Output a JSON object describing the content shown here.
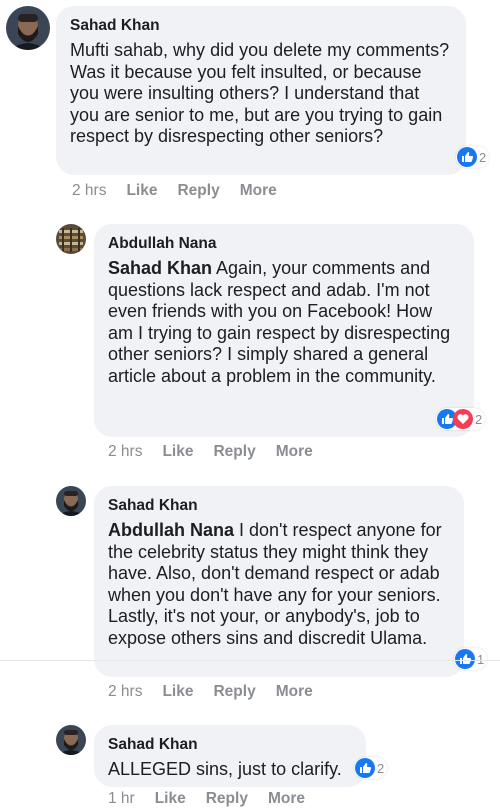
{
  "comments": [
    {
      "author": "Sahad Khan",
      "mention": "",
      "text": "Mufti sahab, why did you delete my comments? Was it because you felt insulted, or because you were insulting others? I understand that you are senior to me, but are you trying to gain respect by disrespecting other seniors?",
      "reaction_count": "2",
      "time": "2 hrs",
      "like": "Like",
      "reply": "Reply",
      "more": "More"
    },
    {
      "author": "Abdullah Nana",
      "mention": "Sahad Khan",
      "text": " Again, your comments and questions lack respect and adab. I'm not even friends with you on Facebook! How am I trying to gain respect by disrespecting other seniors? I simply shared a general article about a problem in the community.",
      "reaction_count": "2",
      "time": "2 hrs",
      "like": "Like",
      "reply": "Reply",
      "more": "More"
    },
    {
      "author": "Sahad Khan",
      "mention": "Abdullah Nana",
      "text": " I don't respect anyone for the celebrity status they might think they have. Also, don't demand respect or adab when you don't have any for your seniors. Lastly, it's not your, or anybody's, job to expose others sins and discredit Ulama.",
      "reaction_count": "1",
      "time": "2 hrs",
      "like": "Like",
      "reply": "Reply",
      "more": "More"
    },
    {
      "author": "Sahad Khan",
      "mention": "",
      "text": "ALLEGED sins, just to clarify.",
      "reaction_count": "2",
      "time": "1 hr",
      "like": "Like",
      "reply": "Reply",
      "more": "More"
    }
  ],
  "colors": {
    "like_blue": "#1877f2",
    "love_red": "#f33e58",
    "bubble_bg": "#f0f2f5",
    "meta_gray": "#8a8d91"
  },
  "icons": {
    "like": "thumbs-up-icon",
    "love": "heart-icon"
  }
}
